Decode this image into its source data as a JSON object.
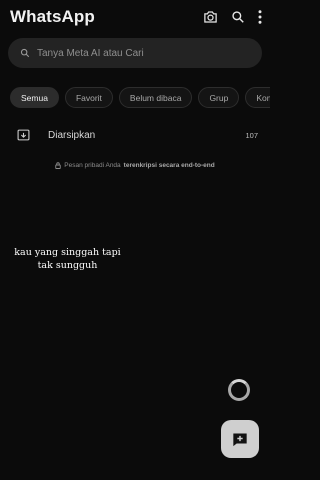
{
  "header": {
    "title": "WhatsApp",
    "icons": [
      "camera-icon",
      "search-icon",
      "more-vertical-icon"
    ]
  },
  "search": {
    "placeholder": "Tanya Meta AI atau Cari",
    "value": ""
  },
  "filters": [
    {
      "label": "Semua",
      "selected": true
    },
    {
      "label": "Favorit",
      "selected": false
    },
    {
      "label": "Belum dibaca",
      "selected": false
    },
    {
      "label": "Grup",
      "selected": false
    },
    {
      "label": "Kom",
      "selected": false
    }
  ],
  "archived": {
    "label": "Diarsipkan",
    "count": "107"
  },
  "encryption": {
    "prefix": "Pesan pribadi Anda",
    "emphasis": "terenkripsi secara end-to-end"
  },
  "overlay_caption": {
    "line1": "kau yang singgah tapi",
    "line2": "tak sungguh"
  },
  "colors": {
    "background": "#0b0b0b",
    "search_bg": "#232323",
    "chip_active_bg": "#2c2c2c",
    "fab_bg": "#cfcfcf"
  }
}
